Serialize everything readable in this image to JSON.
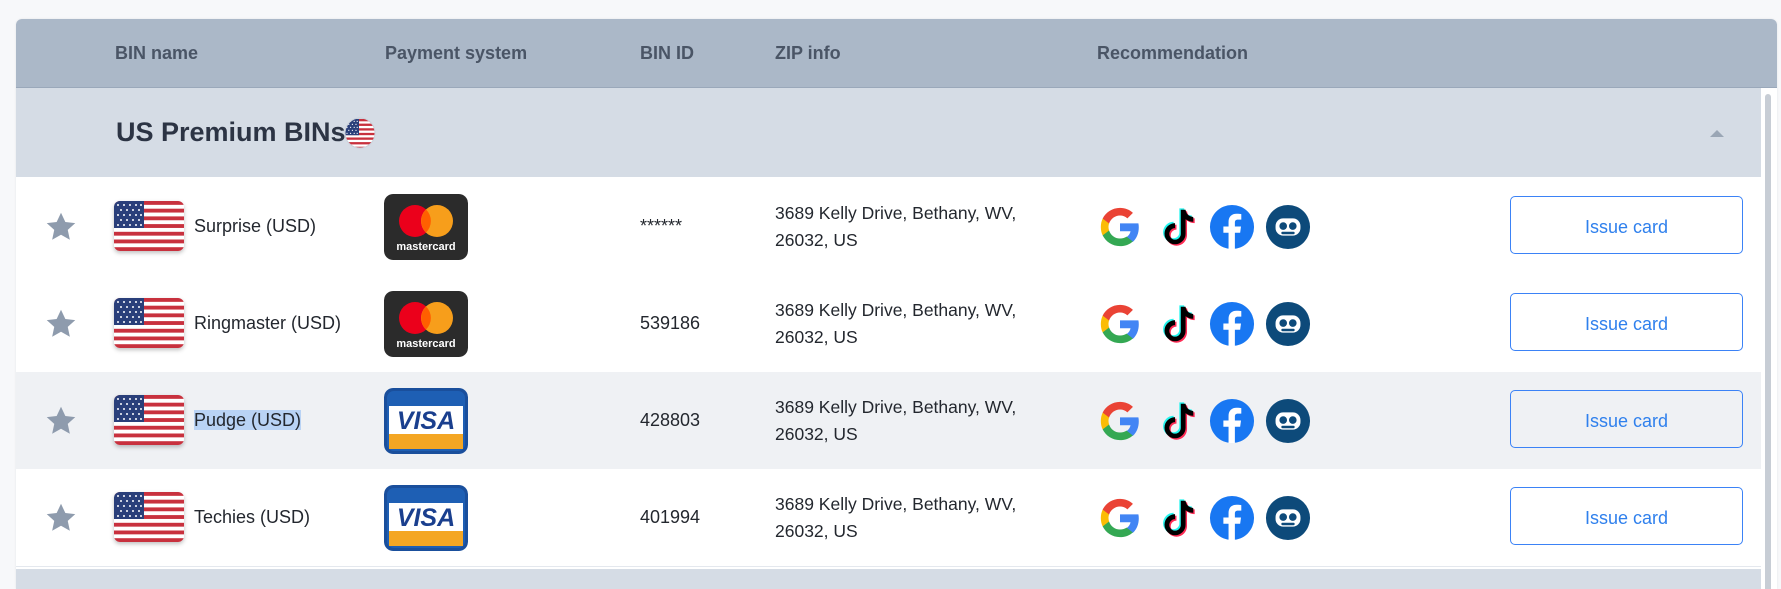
{
  "header": {
    "columns": [
      "BIN name",
      "Payment system",
      "BIN ID",
      "ZIP info",
      "Recommendation"
    ]
  },
  "group": {
    "title": "US Premium BINs",
    "flag_icon": "us-flag-icon",
    "collapse_icon": "caret-up-icon"
  },
  "rows": [
    {
      "name": "Surprise (USD)",
      "payment_system": "mastercard",
      "bin_id": "******",
      "zip_line1": "3689 Kelly Drive, Bethany, WV,",
      "zip_line2": "26032, US",
      "action": "Issue card"
    },
    {
      "name": "Ringmaster (USD)",
      "payment_system": "mastercard",
      "bin_id": "539186",
      "zip_line1": "3689 Kelly Drive, Bethany, WV,",
      "zip_line2": "26032, US",
      "action": "Issue card"
    },
    {
      "name": "Pudge (USD)",
      "payment_system": "visa",
      "bin_id": "428803",
      "zip_line1": "3689 Kelly Drive, Bethany, WV,",
      "zip_line2": "26032, US",
      "action": "Issue card"
    },
    {
      "name": "Techies (USD)",
      "payment_system": "visa",
      "bin_id": "401994",
      "zip_line1": "3689 Kelly Drive, Bethany, WV,",
      "zip_line2": "26032, US",
      "action": "Issue card"
    }
  ],
  "recommendation_icons": [
    "google-icon",
    "tiktok-icon",
    "facebook-icon",
    "robot-icon"
  ],
  "colors": {
    "header_bg": "#abb8c8",
    "group_bg": "#d5dce5",
    "accent_blue": "#2f80ed",
    "star": "#8e9bad"
  }
}
